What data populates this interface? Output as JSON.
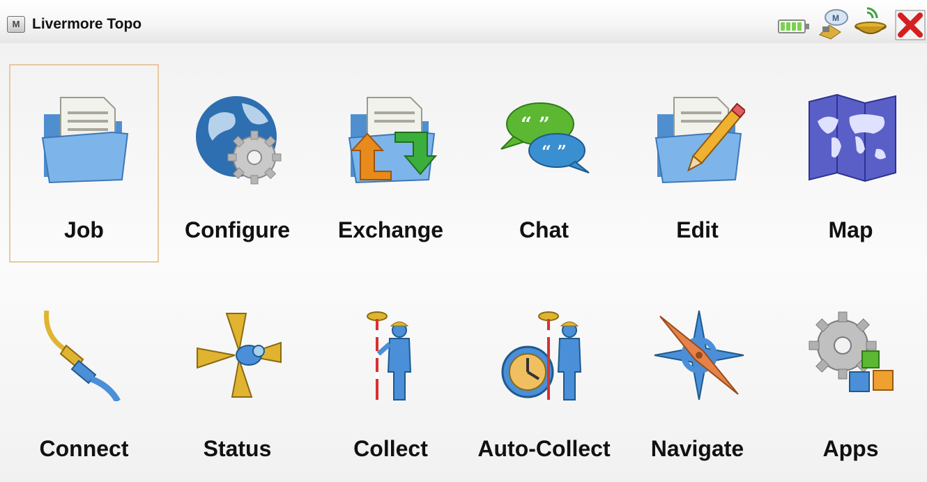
{
  "window": {
    "app_button_label": "M",
    "title": "Livermore Topo",
    "status_icons": [
      "battery-icon",
      "controller-connection-icon",
      "gnss-receiver-icon",
      "close-icon"
    ]
  },
  "menu": {
    "items": [
      {
        "label": "Job",
        "icon": "job-folder-icon",
        "selected": true
      },
      {
        "label": "Configure",
        "icon": "configure-globe-gear-icon"
      },
      {
        "label": "Exchange",
        "icon": "exchange-folder-arrows-icon"
      },
      {
        "label": "Chat",
        "icon": "chat-bubbles-icon"
      },
      {
        "label": "Edit",
        "icon": "edit-folder-pencil-icon"
      },
      {
        "label": "Map",
        "icon": "map-icon"
      },
      {
        "label": "Connect",
        "icon": "connect-cable-icon"
      },
      {
        "label": "Status",
        "icon": "status-propeller-icon"
      },
      {
        "label": "Collect",
        "icon": "collect-surveyor-icon"
      },
      {
        "label": "Auto-Collect",
        "icon": "auto-collect-clock-surveyor-icon"
      },
      {
        "label": "Navigate",
        "icon": "navigate-compass-icon"
      },
      {
        "label": "Apps",
        "icon": "apps-gear-blocks-icon"
      }
    ]
  },
  "colors": {
    "selection_border": "#e8c9a0",
    "close_red": "#d42020",
    "folder_blue": "#5e9fdc",
    "globe_blue": "#2d6fb0"
  }
}
